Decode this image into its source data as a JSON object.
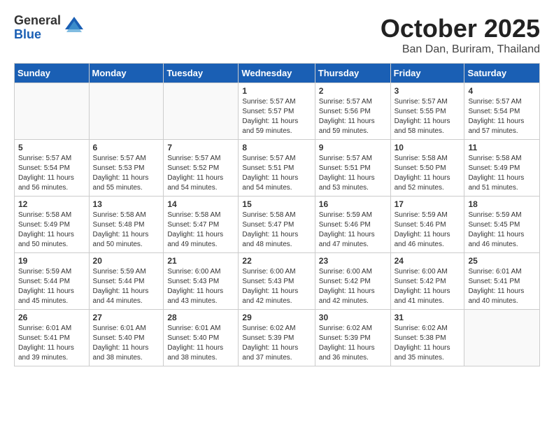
{
  "logo": {
    "general": "General",
    "blue": "Blue"
  },
  "title": "October 2025",
  "location": "Ban Dan, Buriram, Thailand",
  "headers": [
    "Sunday",
    "Monday",
    "Tuesday",
    "Wednesday",
    "Thursday",
    "Friday",
    "Saturday"
  ],
  "weeks": [
    [
      {
        "day": "",
        "info": ""
      },
      {
        "day": "",
        "info": ""
      },
      {
        "day": "",
        "info": ""
      },
      {
        "day": "1",
        "info": "Sunrise: 5:57 AM\nSunset: 5:57 PM\nDaylight: 11 hours\nand 59 minutes."
      },
      {
        "day": "2",
        "info": "Sunrise: 5:57 AM\nSunset: 5:56 PM\nDaylight: 11 hours\nand 59 minutes."
      },
      {
        "day": "3",
        "info": "Sunrise: 5:57 AM\nSunset: 5:55 PM\nDaylight: 11 hours\nand 58 minutes."
      },
      {
        "day": "4",
        "info": "Sunrise: 5:57 AM\nSunset: 5:54 PM\nDaylight: 11 hours\nand 57 minutes."
      }
    ],
    [
      {
        "day": "5",
        "info": "Sunrise: 5:57 AM\nSunset: 5:54 PM\nDaylight: 11 hours\nand 56 minutes."
      },
      {
        "day": "6",
        "info": "Sunrise: 5:57 AM\nSunset: 5:53 PM\nDaylight: 11 hours\nand 55 minutes."
      },
      {
        "day": "7",
        "info": "Sunrise: 5:57 AM\nSunset: 5:52 PM\nDaylight: 11 hours\nand 54 minutes."
      },
      {
        "day": "8",
        "info": "Sunrise: 5:57 AM\nSunset: 5:51 PM\nDaylight: 11 hours\nand 54 minutes."
      },
      {
        "day": "9",
        "info": "Sunrise: 5:57 AM\nSunset: 5:51 PM\nDaylight: 11 hours\nand 53 minutes."
      },
      {
        "day": "10",
        "info": "Sunrise: 5:58 AM\nSunset: 5:50 PM\nDaylight: 11 hours\nand 52 minutes."
      },
      {
        "day": "11",
        "info": "Sunrise: 5:58 AM\nSunset: 5:49 PM\nDaylight: 11 hours\nand 51 minutes."
      }
    ],
    [
      {
        "day": "12",
        "info": "Sunrise: 5:58 AM\nSunset: 5:49 PM\nDaylight: 11 hours\nand 50 minutes."
      },
      {
        "day": "13",
        "info": "Sunrise: 5:58 AM\nSunset: 5:48 PM\nDaylight: 11 hours\nand 50 minutes."
      },
      {
        "day": "14",
        "info": "Sunrise: 5:58 AM\nSunset: 5:47 PM\nDaylight: 11 hours\nand 49 minutes."
      },
      {
        "day": "15",
        "info": "Sunrise: 5:58 AM\nSunset: 5:47 PM\nDaylight: 11 hours\nand 48 minutes."
      },
      {
        "day": "16",
        "info": "Sunrise: 5:59 AM\nSunset: 5:46 PM\nDaylight: 11 hours\nand 47 minutes."
      },
      {
        "day": "17",
        "info": "Sunrise: 5:59 AM\nSunset: 5:46 PM\nDaylight: 11 hours\nand 46 minutes."
      },
      {
        "day": "18",
        "info": "Sunrise: 5:59 AM\nSunset: 5:45 PM\nDaylight: 11 hours\nand 46 minutes."
      }
    ],
    [
      {
        "day": "19",
        "info": "Sunrise: 5:59 AM\nSunset: 5:44 PM\nDaylight: 11 hours\nand 45 minutes."
      },
      {
        "day": "20",
        "info": "Sunrise: 5:59 AM\nSunset: 5:44 PM\nDaylight: 11 hours\nand 44 minutes."
      },
      {
        "day": "21",
        "info": "Sunrise: 6:00 AM\nSunset: 5:43 PM\nDaylight: 11 hours\nand 43 minutes."
      },
      {
        "day": "22",
        "info": "Sunrise: 6:00 AM\nSunset: 5:43 PM\nDaylight: 11 hours\nand 42 minutes."
      },
      {
        "day": "23",
        "info": "Sunrise: 6:00 AM\nSunset: 5:42 PM\nDaylight: 11 hours\nand 42 minutes."
      },
      {
        "day": "24",
        "info": "Sunrise: 6:00 AM\nSunset: 5:42 PM\nDaylight: 11 hours\nand 41 minutes."
      },
      {
        "day": "25",
        "info": "Sunrise: 6:01 AM\nSunset: 5:41 PM\nDaylight: 11 hours\nand 40 minutes."
      }
    ],
    [
      {
        "day": "26",
        "info": "Sunrise: 6:01 AM\nSunset: 5:41 PM\nDaylight: 11 hours\nand 39 minutes."
      },
      {
        "day": "27",
        "info": "Sunrise: 6:01 AM\nSunset: 5:40 PM\nDaylight: 11 hours\nand 38 minutes."
      },
      {
        "day": "28",
        "info": "Sunrise: 6:01 AM\nSunset: 5:40 PM\nDaylight: 11 hours\nand 38 minutes."
      },
      {
        "day": "29",
        "info": "Sunrise: 6:02 AM\nSunset: 5:39 PM\nDaylight: 11 hours\nand 37 minutes."
      },
      {
        "day": "30",
        "info": "Sunrise: 6:02 AM\nSunset: 5:39 PM\nDaylight: 11 hours\nand 36 minutes."
      },
      {
        "day": "31",
        "info": "Sunrise: 6:02 AM\nSunset: 5:38 PM\nDaylight: 11 hours\nand 35 minutes."
      },
      {
        "day": "",
        "info": ""
      }
    ]
  ]
}
